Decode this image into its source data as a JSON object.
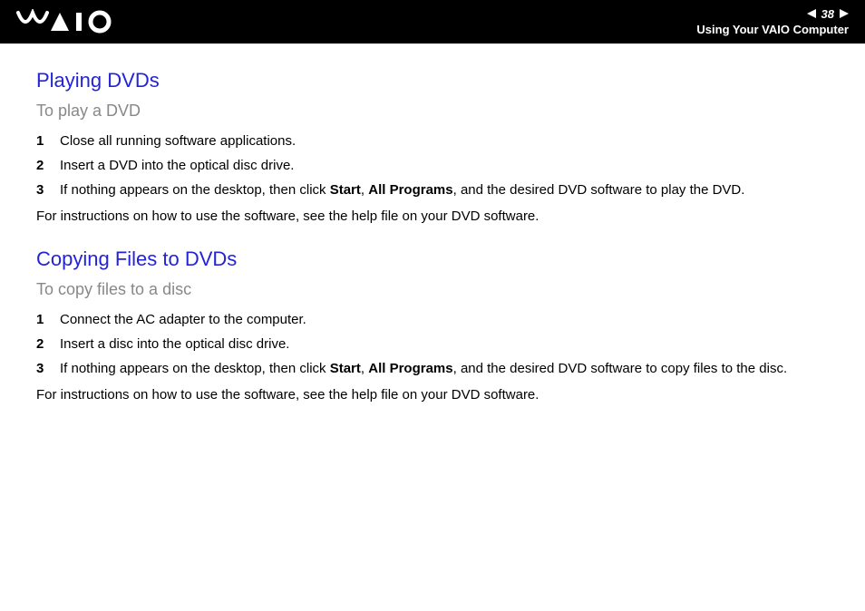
{
  "header": {
    "page_number": "38",
    "section": "Using Your VAIO Computer"
  },
  "section1": {
    "title": "Playing DVDs",
    "subtitle": "To play a DVD",
    "steps": [
      {
        "n": "1",
        "text": "Close all running software applications."
      },
      {
        "n": "2",
        "text": "Insert a DVD into the optical disc drive."
      },
      {
        "n": "3",
        "prefix": "If nothing appears on the desktop, then click ",
        "bold1": "Start",
        "mid1": ", ",
        "bold2": "All Programs",
        "suffix": ", and the desired DVD software to play the DVD."
      }
    ],
    "para": "For instructions on how to use the software, see the help file on your DVD software."
  },
  "section2": {
    "title": "Copying Files to DVDs",
    "subtitle": "To copy files to a disc",
    "steps": [
      {
        "n": "1",
        "text": "Connect the AC adapter to the computer."
      },
      {
        "n": "2",
        "text": "Insert a disc into the optical disc drive."
      },
      {
        "n": "3",
        "prefix": "If nothing appears on the desktop, then click ",
        "bold1": "Start",
        "mid1": ", ",
        "bold2": "All Programs",
        "suffix": ", and the desired DVD software to copy files to the disc."
      }
    ],
    "para": "For instructions on how to use the software, see the help file on your DVD software."
  }
}
